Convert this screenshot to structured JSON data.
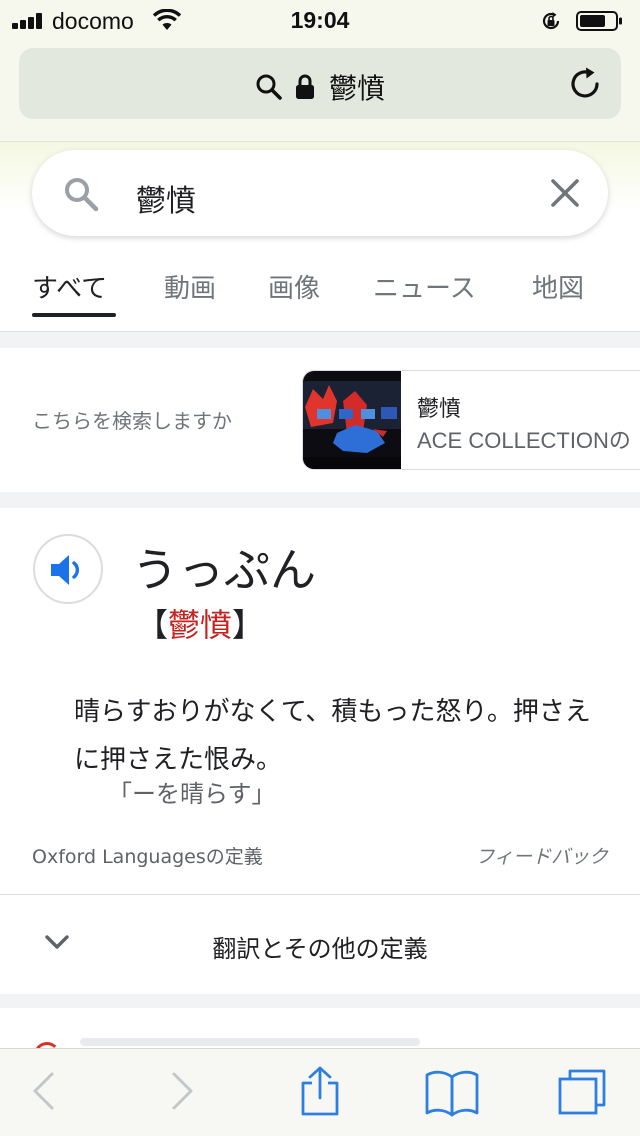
{
  "status_bar": {
    "carrier": "docomo",
    "time": "19:04"
  },
  "address_bar": {
    "text": "鬱憤"
  },
  "search": {
    "query": "鬱憤"
  },
  "tabs": [
    {
      "label": "すべて",
      "active": true
    },
    {
      "label": "動画"
    },
    {
      "label": "画像"
    },
    {
      "label": "ニュース"
    },
    {
      "label": "地図"
    }
  ],
  "suggestion": {
    "label": "こちらを検索しますか",
    "title": "鬱憤",
    "subtitle": "ACE COLLECTIONの"
  },
  "dictionary": {
    "reading": "うっぷん",
    "bracket_open": "【",
    "kanji": "鬱憤",
    "bracket_close": "】",
    "definition": "晴らすおりがなくて、積もった怒り。押さえに押さえた恨み。",
    "example": "「ーを晴らす」",
    "source": "Oxford Languagesの定義",
    "feedback": "フィードバック",
    "more": "翻訳とその他の定義"
  },
  "colors": {
    "accent_blue": "#1a73e8",
    "kanji_red": "#c5221f",
    "safari_blue": "#2f7fe0"
  },
  "icons": [
    "search-icon",
    "lock-icon",
    "reload-icon",
    "close-icon",
    "speaker-icon",
    "chevron-down-icon",
    "back-icon",
    "forward-icon",
    "share-icon",
    "bookmarks-icon",
    "tabs-icon"
  ]
}
